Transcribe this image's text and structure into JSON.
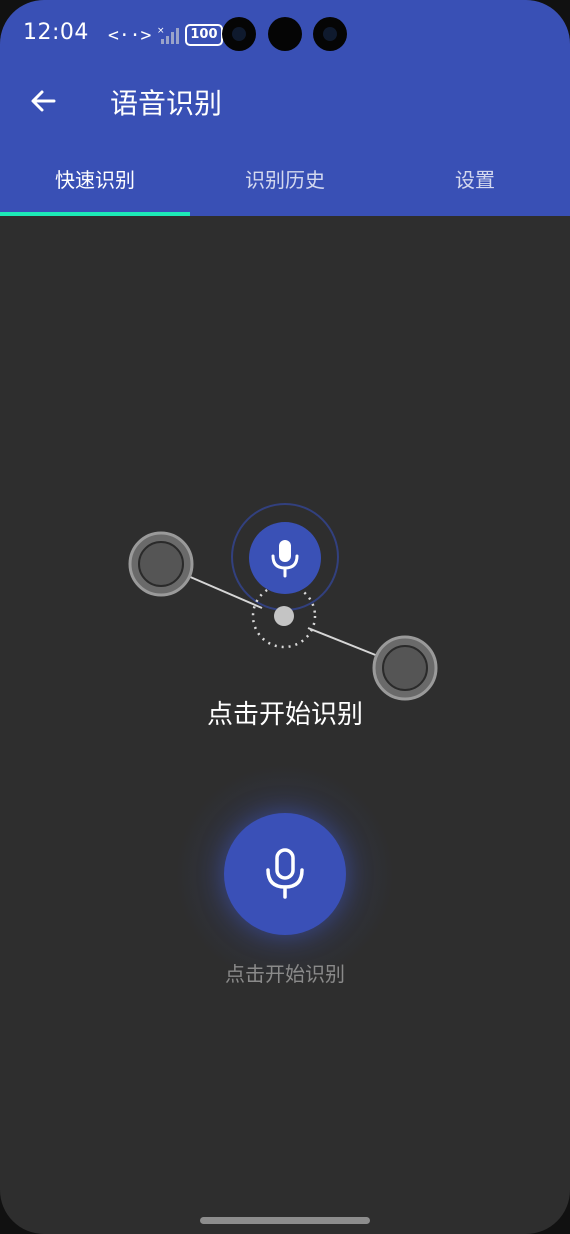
{
  "status_bar": {
    "time": "12:04",
    "data_icon_text": "<··>",
    "battery": "100"
  },
  "toolbar": {
    "title": "语音识别",
    "back_icon": "arrow-back-icon"
  },
  "tabs": [
    {
      "label": "快速识别",
      "active": true
    },
    {
      "label": "识别历史",
      "active": false
    },
    {
      "label": "设置",
      "active": false
    }
  ],
  "tutorial": {
    "text": "点击开始识别"
  },
  "record": {
    "caption": "点击开始识别",
    "icon": "microphone-icon"
  },
  "colors": {
    "primary": "#3950b5",
    "indicator": "#1de9b6",
    "background": "#2e2e2e",
    "caption": "#8a8a8a"
  }
}
